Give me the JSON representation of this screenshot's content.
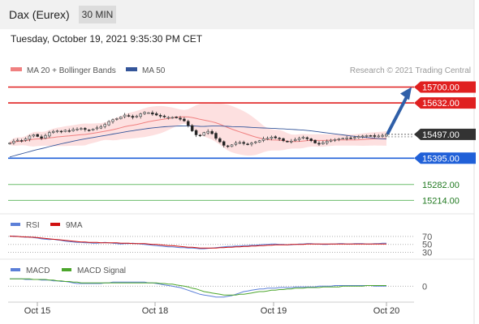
{
  "header": {
    "title": "Dax (Eurex)",
    "interval_button": "30 MIN"
  },
  "timestamp": "Tuesday, October 19, 2021 9:35:30 PM CET",
  "colors": {
    "bollinger": "#f08080",
    "bb_fill": "#fde0e0",
    "ma50": "#34559a",
    "resistance": "#e02020",
    "current": "#333333",
    "pivot": "#2060d8",
    "support": "#6cbd6c",
    "arrow": "#2f5fa8",
    "rsi": "#5b7fd8",
    "rsi_ma": "#d01010",
    "macd": "#5b7fd8",
    "macd_signal": "#4ca62c",
    "candle_up": "#dcdcdc",
    "candle_down": "#222222"
  },
  "chart_data": [
    {
      "type": "candlestick",
      "legend": [
        {
          "name": "MA 20 + Bollinger Bands",
          "color": "#f08080"
        },
        {
          "name": "MA 50",
          "color": "#34559a"
        }
      ],
      "copyright": "Research © 2021 Trading Central",
      "ylim": [
        15170,
        15740
      ],
      "levels": [
        {
          "value": 15700,
          "label": "15700.00",
          "kind": "resistance"
        },
        {
          "value": 15632,
          "label": "15632.00",
          "kind": "resistance"
        },
        {
          "value": 15497,
          "label": "15497.00",
          "kind": "current"
        },
        {
          "value": 15395,
          "label": "15395.00",
          "kind": "pivot"
        },
        {
          "value": 15282,
          "label": "15282.00",
          "kind": "support"
        },
        {
          "value": 15214,
          "label": "15214.00",
          "kind": "support"
        }
      ],
      "x_ticks": [
        "Oct 15",
        "Oct 18",
        "Oct 19",
        "Oct 20"
      ],
      "closes": [
        15460,
        15468,
        15472,
        15470,
        15478,
        15490,
        15495,
        15488,
        15480,
        15492,
        15505,
        15510,
        15512,
        15508,
        15515,
        15512,
        15518,
        15520,
        15522,
        15518,
        15515,
        15520,
        15525,
        15530,
        15540,
        15552,
        15560,
        15565,
        15572,
        15580,
        15575,
        15570,
        15575,
        15585,
        15592,
        15590,
        15584,
        15580,
        15575,
        15572,
        15570,
        15570,
        15568,
        15562,
        15555,
        15535,
        15512,
        15495,
        15492,
        15505,
        15510,
        15500,
        15480,
        15465,
        15450,
        15445,
        15452,
        15460,
        15462,
        15458,
        15455,
        15460,
        15465,
        15470,
        15478,
        15480,
        15485,
        15482,
        15478,
        15470,
        15465,
        15468,
        15475,
        15480,
        15485,
        15478,
        15470,
        15460,
        15455,
        15462,
        15468,
        15472,
        15475,
        15478,
        15480,
        15482,
        15480,
        15484,
        15488,
        15490,
        15492,
        15490,
        15488,
        15490,
        15492,
        15497
      ]
    },
    {
      "type": "line",
      "legend": [
        {
          "name": "RSI",
          "color": "#5b7fd8"
        },
        {
          "name": "9MA",
          "color": "#d01010"
        }
      ],
      "ylim": [
        25,
        78
      ],
      "ref_lines": [
        70,
        50,
        30
      ],
      "tick_labels": [
        "70",
        "50",
        "30"
      ],
      "series": [
        {
          "name": "RSI",
          "values": [
            70,
            71,
            70,
            69,
            68,
            69,
            67,
            66,
            64,
            63,
            62,
            63,
            61,
            60,
            58,
            57,
            56,
            55,
            55,
            54,
            54,
            53,
            53,
            54,
            55,
            54,
            53,
            52,
            51,
            52,
            52,
            53,
            52,
            51,
            50,
            49,
            48,
            47,
            46,
            45,
            44,
            44,
            43,
            42,
            42,
            41,
            41,
            40,
            39,
            39,
            40,
            41,
            42,
            43,
            44,
            45,
            45,
            46,
            46,
            47,
            47,
            48,
            48,
            49,
            50,
            50,
            51,
            51,
            50,
            50,
            49,
            49,
            50,
            51,
            51,
            52,
            52,
            51,
            51,
            50,
            50,
            51,
            51,
            52,
            52,
            51,
            51,
            52,
            52,
            52,
            51,
            51,
            52,
            52,
            53,
            53
          ]
        },
        {
          "name": "9MA",
          "values": [
            71,
            70,
            70,
            69,
            69,
            68,
            68,
            67,
            66,
            65,
            64,
            63,
            62,
            61,
            60,
            59,
            58,
            57,
            56,
            56,
            55,
            55,
            55,
            54,
            54,
            54,
            54,
            54,
            53,
            53,
            53,
            52,
            52,
            52,
            52,
            51,
            50,
            50,
            49,
            48,
            47,
            47,
            46,
            45,
            44,
            43,
            43,
            42,
            41,
            41,
            41,
            41,
            41,
            42,
            42,
            43,
            43,
            44,
            44,
            45,
            45,
            46,
            46,
            47,
            47,
            48,
            48,
            49,
            49,
            49,
            49,
            50,
            50,
            50,
            50,
            51,
            51,
            51,
            51,
            51,
            51,
            51,
            51,
            51,
            51,
            51,
            51,
            51,
            51,
            51,
            51,
            51,
            51,
            51,
            51,
            51
          ]
        }
      ]
    },
    {
      "type": "line",
      "legend": [
        {
          "name": "MACD",
          "color": "#5b7fd8"
        },
        {
          "name": "MACD Signal",
          "color": "#4ca62c"
        }
      ],
      "ylim": [
        -20,
        16
      ],
      "ref_lines": [
        0
      ],
      "tick_labels": [
        "0"
      ],
      "series": [
        {
          "name": "MACD",
          "values": [
            11,
            11,
            11,
            11,
            10,
            10,
            10,
            10,
            9,
            9,
            9,
            8,
            8,
            7,
            7,
            6,
            5,
            4,
            4,
            4,
            4,
            4,
            4,
            4,
            5,
            5,
            6,
            6,
            6,
            6,
            6,
            6,
            6,
            6,
            6,
            5,
            5,
            4,
            3,
            2,
            1,
            0,
            -1,
            -2,
            -4,
            -6,
            -8,
            -10,
            -12,
            -13,
            -14,
            -15,
            -16,
            -16,
            -16,
            -15,
            -14,
            -12,
            -10,
            -8,
            -7,
            -6,
            -5,
            -4,
            -4,
            -3,
            -3,
            -3,
            -2,
            -2,
            -2,
            -2,
            -1,
            -1,
            -1,
            -1,
            -1,
            -1,
            0,
            0,
            0,
            0,
            1,
            1,
            1,
            1,
            1,
            1,
            1,
            1,
            1,
            1,
            0,
            0,
            0,
            0
          ]
        },
        {
          "name": "MACD Signal",
          "values": [
            11,
            11,
            11,
            11,
            11,
            11,
            10,
            10,
            10,
            10,
            9,
            9,
            8,
            8,
            7,
            7,
            6,
            6,
            5,
            5,
            5,
            5,
            5,
            5,
            5,
            5,
            5,
            5,
            5,
            5,
            5,
            5,
            5,
            5,
            5,
            5,
            5,
            5,
            4,
            4,
            3,
            3,
            2,
            1,
            0,
            -1,
            -3,
            -4,
            -6,
            -8,
            -9,
            -10,
            -11,
            -12,
            -13,
            -13,
            -13,
            -13,
            -12,
            -12,
            -11,
            -10,
            -9,
            -8,
            -8,
            -7,
            -6,
            -6,
            -5,
            -5,
            -4,
            -4,
            -3,
            -3,
            -3,
            -2,
            -2,
            -2,
            -2,
            -1,
            -1,
            -1,
            -1,
            -1,
            0,
            0,
            0,
            0,
            0,
            0,
            1,
            1,
            1,
            1,
            1,
            1
          ]
        }
      ]
    }
  ]
}
